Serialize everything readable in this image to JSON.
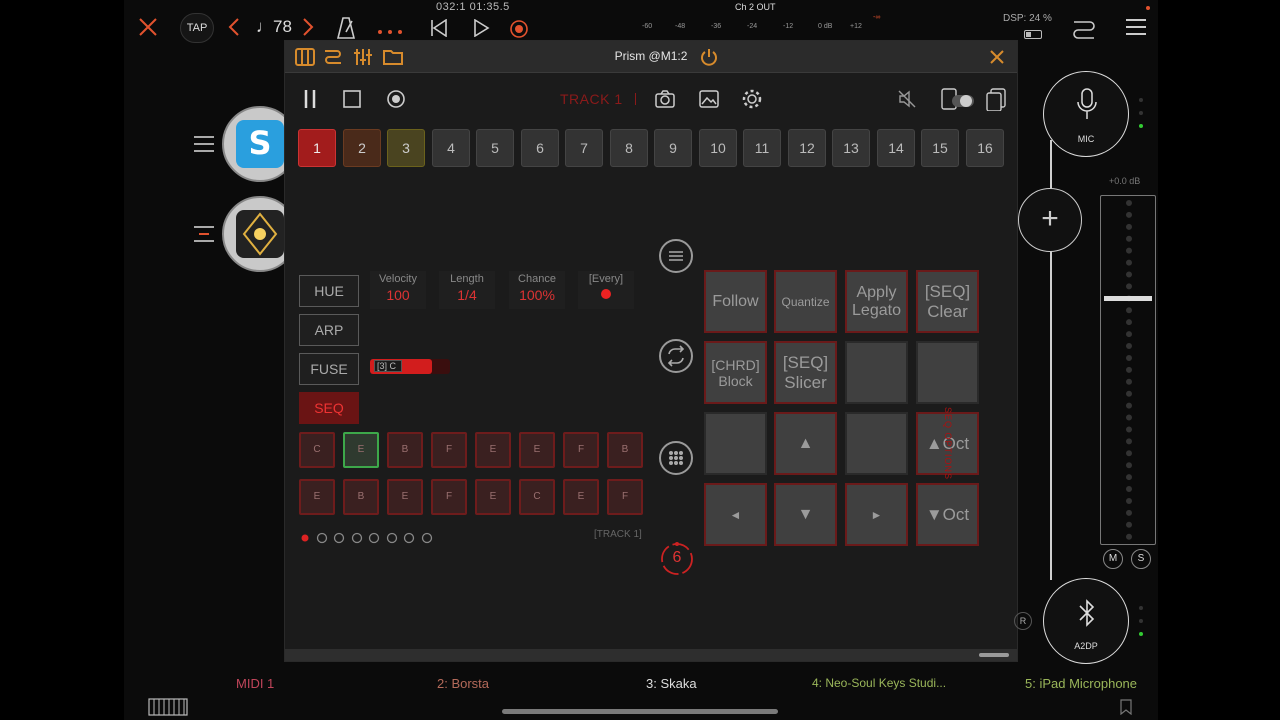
{
  "topbar": {
    "tap_label": "TAP",
    "tempo": "♩78",
    "position": "032:1  01:35.5",
    "output_title": "Ch 2 OUT",
    "meter_ticks": [
      "-60",
      "-48",
      "-36",
      "-24",
      "-12",
      "0 dB",
      "+12",
      "-∞"
    ],
    "dsp": "DSP: 24 %",
    "accent": "#e2522e"
  },
  "plugin": {
    "title": "Prism @M1:2",
    "track_label": "TRACK 1",
    "track_numbers": [
      "1",
      "2",
      "3",
      "4",
      "5",
      "6",
      "7",
      "8",
      "9",
      "10",
      "11",
      "12",
      "13",
      "14",
      "15",
      "16"
    ],
    "mode_buttons": [
      "HUE",
      "ARP",
      "FUSE",
      "SEQ"
    ],
    "params": [
      {
        "label": "Velocity",
        "value": "100"
      },
      {
        "label": "Length",
        "value": "1/4"
      },
      {
        "label": "Chance",
        "value": "100%"
      },
      {
        "label": "[Every]",
        "value": ""
      }
    ],
    "fuse_slider_label": "[3] C",
    "notes_row1": [
      "C",
      "E",
      "B",
      "F",
      "E",
      "E",
      "F",
      "B"
    ],
    "notes_row2": [
      "E",
      "B",
      "E",
      "F",
      "E",
      "C",
      "E",
      "F"
    ],
    "track_tag": "[TRACK 1]",
    "pads": [
      "Follow",
      "Quantize",
      "Apply Legato",
      "[SEQ] Clear",
      "[CHRD] Block",
      "[SEQ] Slicer",
      "",
      "",
      "",
      "▲",
      "",
      "▲Oct",
      "◄",
      "▼",
      "►",
      "▼Oct"
    ],
    "seq_options_label": "SEQ OPTIONS",
    "counter": "6"
  },
  "rail": {
    "mic_label": "MIC",
    "gain": "+0.0 dB",
    "mute": "M",
    "solo": "S",
    "bt_label": "A2DP",
    "r_label": "R"
  },
  "channels": [
    {
      "label": "MIDI 1",
      "color": "#c0455a"
    },
    {
      "label": "2: Borsta",
      "color": "#b46a5a"
    },
    {
      "label": "3: Skaka",
      "color": "#dddddd"
    },
    {
      "label": "4: Neo-Soul Keys Studi...",
      "color": "#9ab65a"
    },
    {
      "label": "5: iPad Microphone",
      "color": "#9ab65a"
    }
  ]
}
